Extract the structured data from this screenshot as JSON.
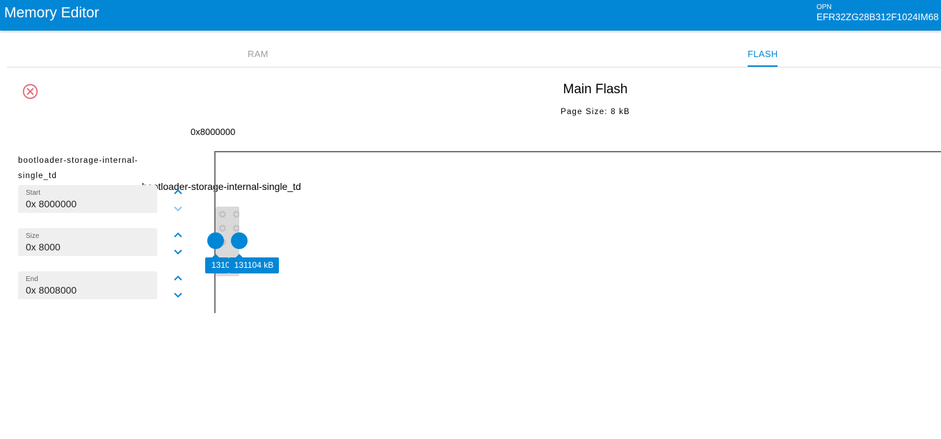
{
  "app": {
    "title": "Memory Editor",
    "opn_label": "OPN",
    "opn_value": "EFR32ZG28B312F1024IM68"
  },
  "tabs": [
    {
      "label": "RAM",
      "selected": false
    },
    {
      "label": "FLASH",
      "selected": true
    }
  ],
  "main": {
    "title": "Main Flash",
    "page_size": "Page Size: 8 kB",
    "start_address": "0x8000000",
    "block_label": "bootloader-storage-internal-single_td"
  },
  "region": {
    "name": "bootloader-storage-internal-single_td",
    "start": {
      "label": "Start",
      "value": "0x 8000000"
    },
    "size": {
      "label": "Size",
      "value": "0x 8000"
    },
    "end": {
      "label": "End",
      "value": "0x 8008000"
    }
  },
  "slider": {
    "left_tooltip": "1310",
    "right_tooltip": "131104 kB"
  },
  "colors": {
    "accent": "#0287d6",
    "close": "#e06a7a",
    "field_bg": "#efefef"
  },
  "icons": {
    "close": "close-circle-icon",
    "up": "chevron-up-icon",
    "down": "chevron-down-icon",
    "chip": "chip-icon"
  }
}
